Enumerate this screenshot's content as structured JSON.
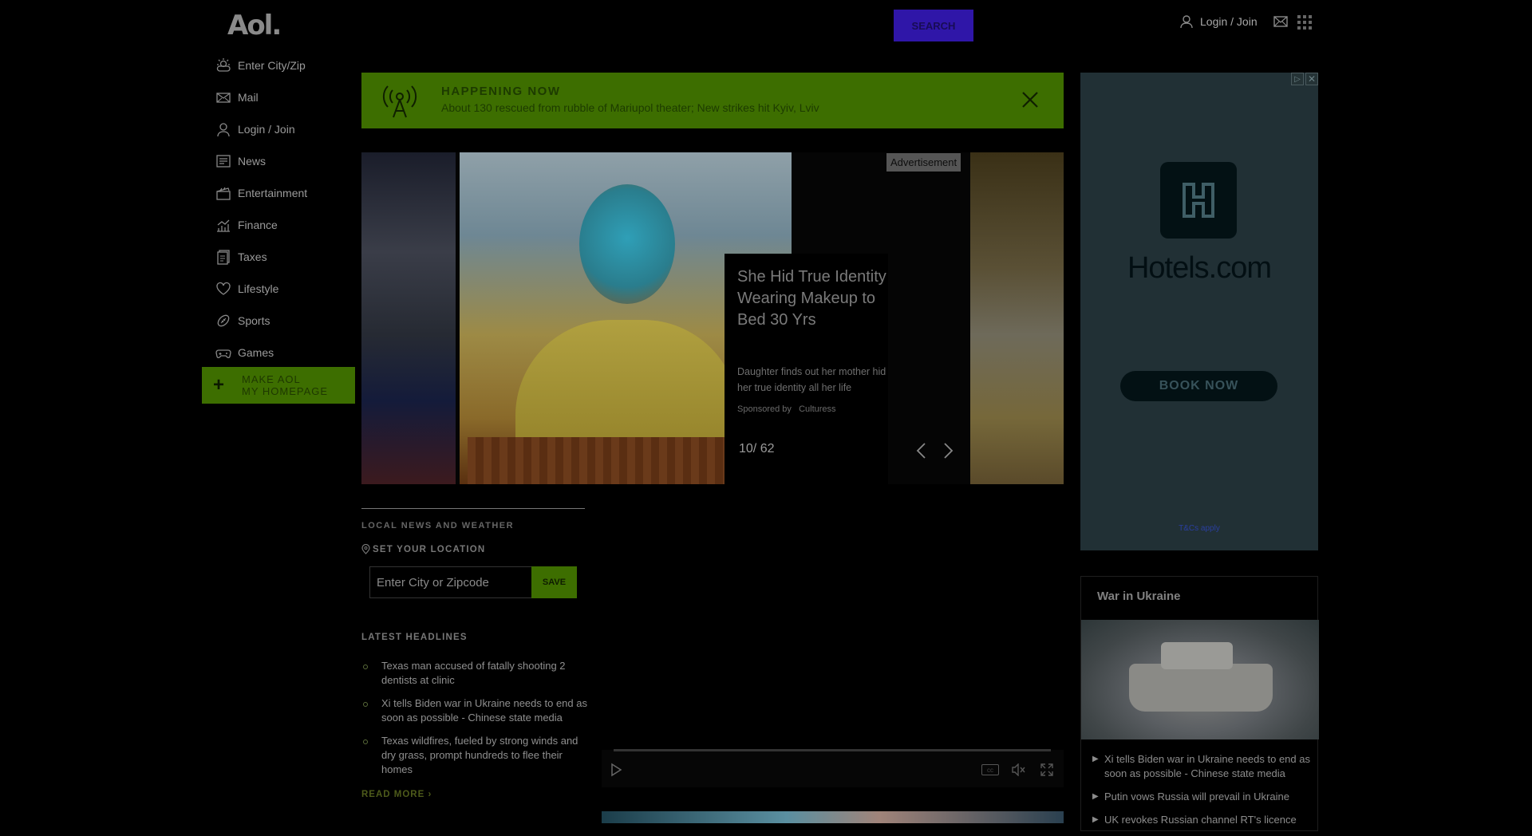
{
  "header": {
    "logo": "Aol.",
    "search_label": "SEARCH",
    "login_label": "Login / Join"
  },
  "nav": {
    "items": [
      {
        "label": "Enter City/Zip",
        "icon": "weather-icon"
      },
      {
        "label": "Mail",
        "icon": "mail-icon"
      },
      {
        "label": "Login / Join",
        "icon": "user-icon"
      },
      {
        "label": "News",
        "icon": "news-icon"
      },
      {
        "label": "Entertainment",
        "icon": "clapper-icon"
      },
      {
        "label": "Finance",
        "icon": "chart-icon"
      },
      {
        "label": "Taxes",
        "icon": "document-icon"
      },
      {
        "label": "Lifestyle",
        "icon": "heart-icon"
      },
      {
        "label": "Sports",
        "icon": "football-icon"
      },
      {
        "label": "Games",
        "icon": "gamepad-icon"
      }
    ],
    "make_home_line1": "MAKE AOL",
    "make_home_line2": "MY HOMEPAGE"
  },
  "happening": {
    "title": "HAPPENING NOW",
    "text": "About 130 rescued from rubble of Mariupol theater; New strikes hit Kyiv, Lviv"
  },
  "carousel": {
    "ad_label": "Advertisement",
    "ad_title": "She Hid True Identity Wearing Makeup to Bed 30 Yrs",
    "ad_desc": "Daughter finds out her mother hid her true identity all her life",
    "sponsored_by": "Sponsored by",
    "sponsor": "Culturess",
    "counter": "10/ 62"
  },
  "local": {
    "heading": "LOCAL NEWS AND WEATHER",
    "set_location": "SET YOUR LOCATION",
    "input_placeholder": "Enter City or Zipcode",
    "save_label": "SAVE"
  },
  "latest": {
    "heading": "LATEST HEADLINES",
    "items": [
      "Texas man accused of fatally shooting 2 dentists at clinic",
      "Xi tells Biden war in Ukraine needs to end as soon as possible - Chinese state media",
      "Texas wildfires, fueled by strong winds and dry grass, prompt hundreds to flee their homes"
    ],
    "read_more": "READ MORE ›"
  },
  "player": {
    "cc_label": "cc"
  },
  "right_ad": {
    "brand": "Hotels.com",
    "book_label": "BOOK NOW",
    "tcs": "T&Cs apply"
  },
  "ukraine": {
    "title": "War in Ukraine",
    "items": [
      "Xi tells Biden war in Ukraine needs to end as soon as possible - Chinese state media",
      "Putin vows Russia will prevail in Ukraine",
      "UK revokes Russian channel RT's licence"
    ]
  },
  "colors": {
    "accent_green": "#3d6e00",
    "search_blue": "#2f16a8",
    "ad_teal": "#213035"
  }
}
